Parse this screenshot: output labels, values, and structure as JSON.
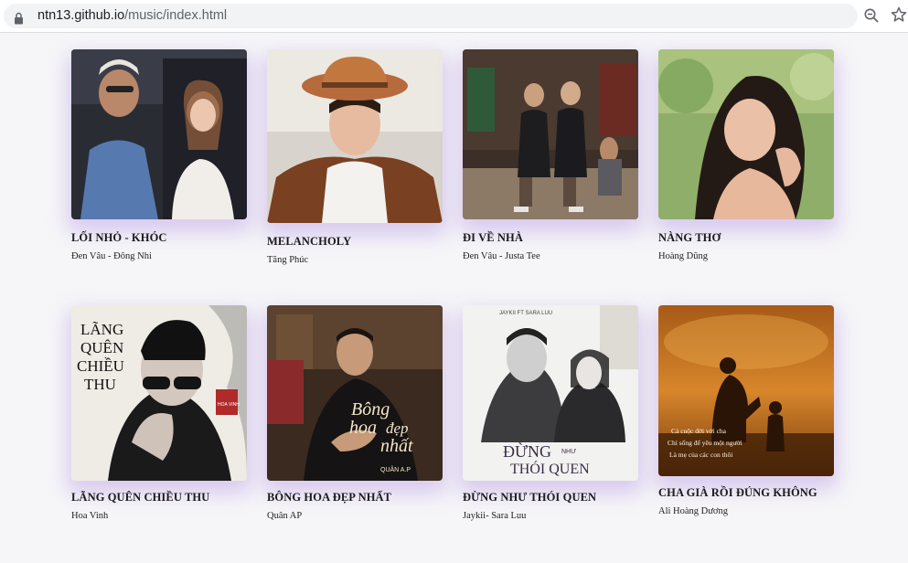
{
  "browser": {
    "url_host": "ntn13.github.io",
    "url_path": "/music/index.html"
  },
  "songs": [
    {
      "title": "LỐI NHỎ - KHÓC",
      "artist": "Đen Vâu - Đông Nhi"
    },
    {
      "title": "MELANCHOLY",
      "artist": "Tăng Phúc"
    },
    {
      "title": "ĐI VỀ NHÀ",
      "artist": "Đen Vâu - Justa Tee"
    },
    {
      "title": "NÀNG THƠ",
      "artist": "Hoàng Dũng"
    },
    {
      "title": "LÃNG QUÊN CHIỀU THU",
      "artist": "Hoa Vinh"
    },
    {
      "title": "BÔNG HOA ĐẸP NHẤT",
      "artist": "Quân AP"
    },
    {
      "title": "ĐỪNG NHƯ THÓI QUEN",
      "artist": "Jaykii- Sara Luu"
    },
    {
      "title": "CHA GIÀ RỒI ĐÚNG KHÔNG",
      "artist": "Ali Hoàng Dương"
    }
  ],
  "cover_text": {
    "lang_quen_lines": [
      "LÃNG",
      "QUÊN",
      "CHIỀU",
      "THU"
    ],
    "hoa_vinh_stamp": "HOA VINH",
    "bong_hoa_lines": [
      "Bông",
      "hoa",
      "đẹp",
      "nhất"
    ],
    "quan_ap": "QUÂN A.P",
    "jaykii_header": "JAYKII FT SARA LUU",
    "dung_nhu_lines": [
      "ĐỪNG",
      "NHƯ",
      "THÓI QUEN"
    ],
    "cha_gia_quote": [
      "Cả cuộc đời với cha",
      "Chỉ sống để yêu một người",
      "Là mẹ của các con thôi"
    ]
  },
  "colors": {
    "shadow_accent": "#a078dc",
    "cha_gia_orange": "#d7862b"
  }
}
